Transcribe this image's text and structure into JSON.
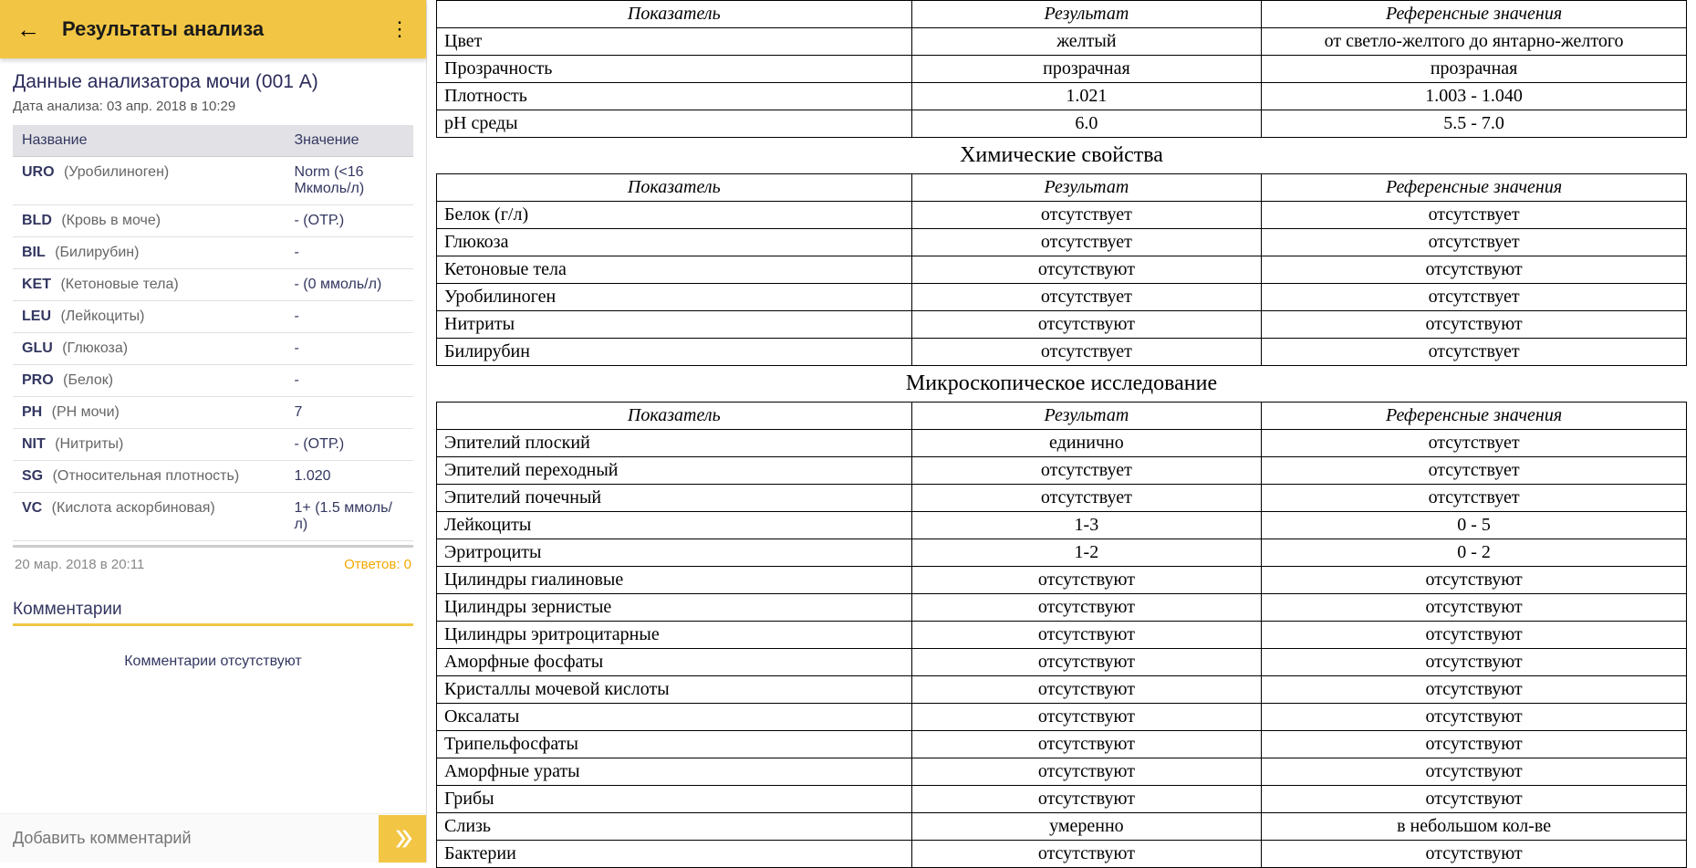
{
  "app": {
    "title": "Результаты анализа",
    "back_icon": "←",
    "menu_icon": "⋮"
  },
  "main": {
    "heading": "Данные анализатора мочи (001 A)",
    "date_label": "Дата анализа: 03 апр. 2018 в 10:29",
    "columns": {
      "name": "Название",
      "value": "Значение"
    },
    "rows": [
      {
        "code": "URO",
        "desc": "(Уробилиноген)",
        "value": "Norm (<16 Мкмоль/л)"
      },
      {
        "code": "BLD",
        "desc": "(Кровь в моче)",
        "value": "- (ОТР.)"
      },
      {
        "code": "BIL",
        "desc": "(Билирубин)",
        "value": "-"
      },
      {
        "code": "KET",
        "desc": "(Кетоновые тела)",
        "value": "- (0 ммоль/л)"
      },
      {
        "code": "LEU",
        "desc": "(Лейкоциты)",
        "value": "-"
      },
      {
        "code": "GLU",
        "desc": "(Глюкоза)",
        "value": "-"
      },
      {
        "code": "PRO",
        "desc": "(Белок)",
        "value": "-"
      },
      {
        "code": "PH",
        "desc": "(РН мочи)",
        "value": "7"
      },
      {
        "code": "NIT",
        "desc": "(Нитриты)",
        "value": "- (ОТР.)"
      },
      {
        "code": "SG",
        "desc": "(Относительная плотность)",
        "value": "1.020"
      },
      {
        "code": "VC",
        "desc": "(Кислота аскорбиновая)",
        "value": "1+ (1.5 ммоль/л)"
      }
    ],
    "footer_date": "20 мар. 2018 в 20:11",
    "answers": "Ответов: 0"
  },
  "comments": {
    "header": "Комментарии",
    "empty": "Комментарии отсутствуют",
    "placeholder": "Добавить комментарий"
  },
  "doc": {
    "headers": {
      "param": "Показатель",
      "result": "Результат",
      "ref": "Референсные значения"
    },
    "sections": [
      {
        "title": "",
        "rows": [
          {
            "p": "Цвет",
            "r": "желтый",
            "f": "от светло-желтого до янтарно-желтого"
          },
          {
            "p": "Прозрачность",
            "r": "прозрачная",
            "f": "прозрачная"
          },
          {
            "p": "Плотность",
            "r": "1.021",
            "f": "1.003 - 1.040"
          },
          {
            "p": "рН среды",
            "r": "6.0",
            "f": "5.5 - 7.0"
          }
        ]
      },
      {
        "title": "Химические свойства",
        "rows": [
          {
            "p": "Белок (г/л)",
            "r": "отсутствует",
            "f": "отсутствует"
          },
          {
            "p": "Глюкоза",
            "r": "отсутствует",
            "f": "отсутствует"
          },
          {
            "p": "Кетоновые тела",
            "r": "отсутствуют",
            "f": "отсутствуют"
          },
          {
            "p": "Уробилиноген",
            "r": "отсутствует",
            "f": "отсутствует"
          },
          {
            "p": "Нитриты",
            "r": "отсутствуют",
            "f": "отсутствуют"
          },
          {
            "p": "Билирубин",
            "r": "отсутствует",
            "f": "отсутствует"
          }
        ]
      },
      {
        "title": "Микроскопическое исследование",
        "rows": [
          {
            "p": "Эпителий плоский",
            "r": "единично",
            "f": "отсутствует"
          },
          {
            "p": "Эпителий переходный",
            "r": "отсутствует",
            "f": "отсутствует"
          },
          {
            "p": "Эпителий почечный",
            "r": "отсутствует",
            "f": "отсутствует"
          },
          {
            "p": "Лейкоциты",
            "r": "1-3",
            "f": "0 - 5"
          },
          {
            "p": "Эритроциты",
            "r": "1-2",
            "f": "0 - 2"
          },
          {
            "p": "Цилиндры гиалиновые",
            "r": "отсутствуют",
            "f": "отсутствуют"
          },
          {
            "p": "Цилиндры зернистые",
            "r": "отсутствуют",
            "f": "отсутствуют"
          },
          {
            "p": "Цилиндры эритроцитарные",
            "r": "отсутствуют",
            "f": "отсутствуют"
          },
          {
            "p": "Аморфные фосфаты",
            "r": "отсутствуют",
            "f": "отсутствуют"
          },
          {
            "p": "Кристаллы мочевой кислоты",
            "r": "отсутствуют",
            "f": "отсутствуют"
          },
          {
            "p": "Оксалаты",
            "r": "отсутствуют",
            "f": "отсутствуют"
          },
          {
            "p": "Трипельфосфаты",
            "r": "отсутствуют",
            "f": "отсутствуют"
          },
          {
            "p": "Аморфные ураты",
            "r": "отсутствуют",
            "f": "отсутствуют"
          },
          {
            "p": "Грибы",
            "r": "отсутствуют",
            "f": "отсутствуют"
          },
          {
            "p": "Слизь",
            "r": "умеренно",
            "f": "в небольшом кол-ве"
          },
          {
            "p": "Бактерии",
            "r": "отсутствуют",
            "f": "отсутствуют"
          }
        ]
      }
    ]
  }
}
